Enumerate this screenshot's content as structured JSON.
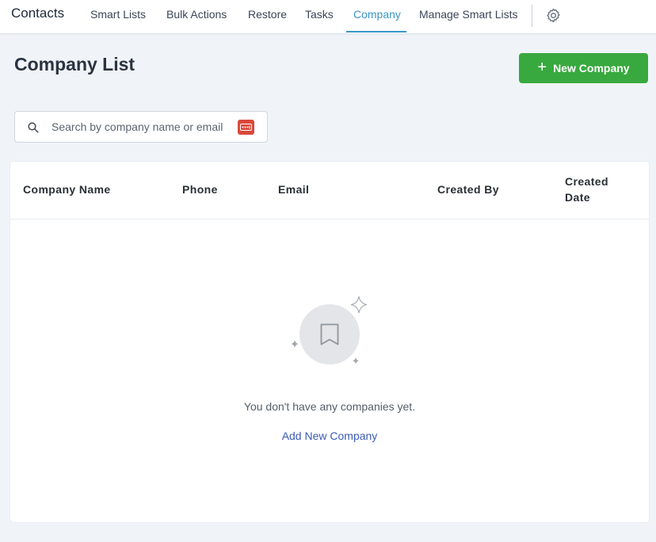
{
  "app": {
    "title": "Contacts"
  },
  "nav": {
    "items": [
      {
        "label": "Smart Lists"
      },
      {
        "label": "Bulk Actions"
      },
      {
        "label": "Restore"
      },
      {
        "label": "Tasks"
      },
      {
        "label": "Company",
        "active": true
      },
      {
        "label": "Manage Smart Lists"
      }
    ],
    "settings_icon": "gear-icon",
    "accent_color": "#3a96c8"
  },
  "header": {
    "title": "Company List",
    "new_button": {
      "label": "New Company",
      "icon": "plus-icon",
      "color": "#38a93e"
    }
  },
  "search": {
    "placeholder": "Search by company name or email",
    "value": "",
    "icon": "search-icon"
  },
  "table": {
    "columns": [
      "Company Name",
      "Phone",
      "Email",
      "Created By",
      "Created Date"
    ],
    "rows": []
  },
  "empty_state": {
    "icon": "bookmark-icon",
    "message": "You don't have any companies yet.",
    "action_label": "Add New Company"
  }
}
